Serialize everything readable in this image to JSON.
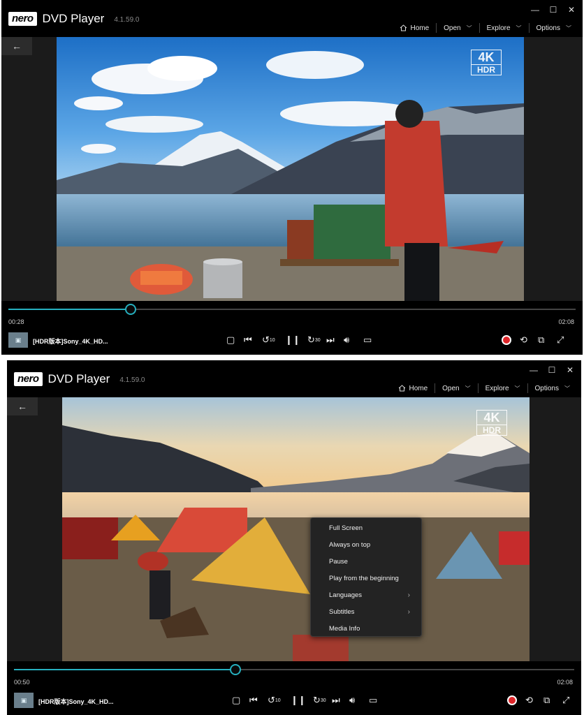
{
  "app": {
    "logo": "nero",
    "title": "DVD Player",
    "version": "4.1.59.0"
  },
  "window_controls": {
    "minimize": "—",
    "maximize": "☐",
    "close": "✕"
  },
  "menu": {
    "home": "Home",
    "open": "Open",
    "explore": "Explore",
    "options": "Options"
  },
  "icons": {
    "home": "home-icon",
    "chevron": "chevron-down-icon",
    "back": "arrow-left-icon",
    "stop": "stop-icon",
    "prev": "skip-previous-icon",
    "rewind": "rewind-10-icon",
    "pause": "pause-icon",
    "forward": "forward-30-icon",
    "next": "skip-next-icon",
    "volume": "volume-icon",
    "subtitles": "subtitles-icon",
    "record": "record-icon",
    "repeat": "repeat-icon",
    "pip": "picture-in-picture-icon",
    "fullscreen": "fullscreen-icon"
  },
  "badge": {
    "k4": "4K",
    "hdr": "HDR"
  },
  "colors": {
    "accent": "#26b0bf",
    "record": "#e0262a",
    "background": "#000000"
  },
  "player1": {
    "current_time": "00:28",
    "total_time": "02:08",
    "progress": 0.215,
    "file_name": "[HDR版本]Sony_4K_HD..."
  },
  "player2": {
    "current_time": "00:50",
    "total_time": "02:08",
    "progress": 0.395,
    "file_name": "[HDR版本]Sony_4K_HD..."
  },
  "controls": {
    "rewind_label": "10",
    "forward_label": "30"
  },
  "context_menu": {
    "items": [
      {
        "label": "Full Screen",
        "submenu": false
      },
      {
        "label": "Always on top",
        "submenu": false
      },
      {
        "label": "Pause",
        "submenu": false
      },
      {
        "label": "Play from the beginning",
        "submenu": false
      },
      {
        "label": "Languages",
        "submenu": true
      },
      {
        "label": "Subtitles",
        "submenu": true
      },
      {
        "label": "Media Info",
        "submenu": false
      }
    ]
  }
}
